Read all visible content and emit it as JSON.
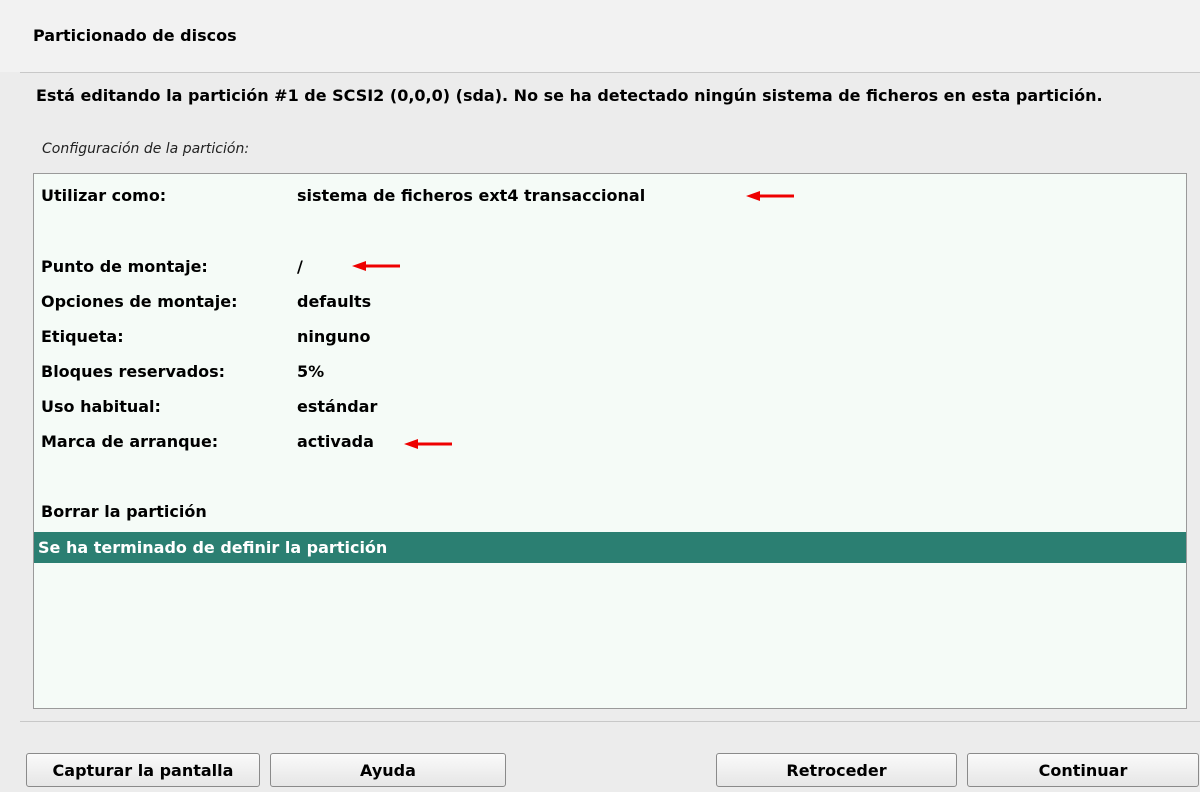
{
  "header": {
    "title": "Particionado de discos"
  },
  "main": {
    "description": "Está editando la partición #1 de SCSI2 (0,0,0) (sda). No se ha detectado ningún sistema de ficheros en esta partición.",
    "subtitle": "Configuración de la partición:"
  },
  "settings": [
    {
      "label": "Utilizar como:",
      "value": "sistema de ficheros ext4 transaccional"
    },
    {
      "label": "Punto de montaje:",
      "value": "/"
    },
    {
      "label": "Opciones de montaje:",
      "value": "defaults"
    },
    {
      "label": "Etiqueta:",
      "value": "ninguno"
    },
    {
      "label": "Bloques reservados:",
      "value": "5%"
    },
    {
      "label": "Uso habitual:",
      "value": "estándar"
    },
    {
      "label": "Marca de arranque:",
      "value": "activada"
    }
  ],
  "actions": {
    "delete": "Borrar la partición",
    "done": "Se ha terminado de definir la partición"
  },
  "buttons": {
    "screenshot": "Capturar la pantalla",
    "help": "Ayuda",
    "back": "Retroceder",
    "continue": "Continuar"
  },
  "colors": {
    "selection": "#2b7f72",
    "list_background": "#f5fbf7",
    "annotation_arrow": "#ee0000"
  }
}
